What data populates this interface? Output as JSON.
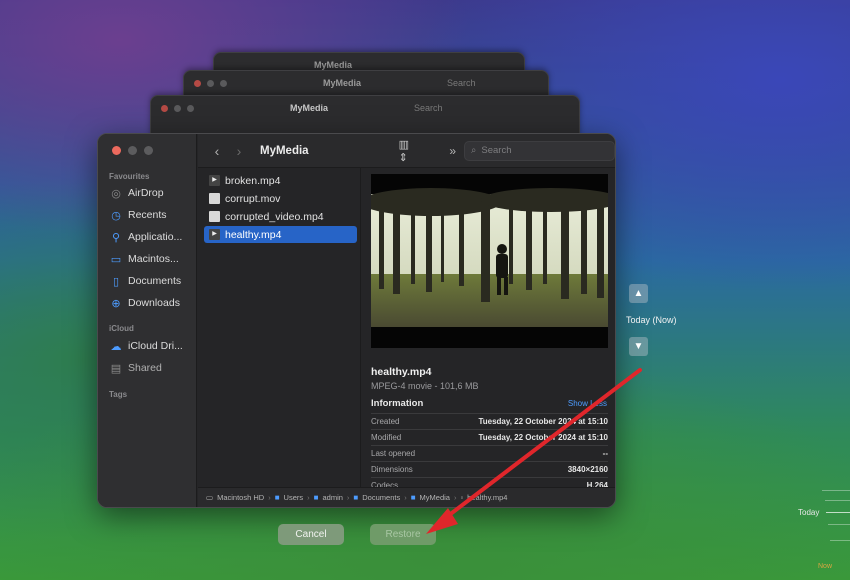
{
  "stack": {
    "title": "MyMedia",
    "search_placeholder": "Search"
  },
  "sidebar": {
    "sections": [
      {
        "label": "Favourites"
      },
      {
        "label": "iCloud"
      },
      {
        "label": "Tags"
      }
    ],
    "items": [
      {
        "label": "AirDrop",
        "icon": "airdrop-icon"
      },
      {
        "label": "Recents",
        "icon": "clock-icon"
      },
      {
        "label": "Applicatio...",
        "icon": "applications-icon"
      },
      {
        "label": "Macintos...",
        "icon": "disk-icon"
      },
      {
        "label": "Documents",
        "icon": "document-icon"
      },
      {
        "label": "Downloads",
        "icon": "download-icon"
      },
      {
        "label": "iCloud Dri...",
        "icon": "cloud-icon"
      },
      {
        "label": "Shared",
        "icon": "shared-folder-icon"
      }
    ]
  },
  "toolbar": {
    "title": "MyMedia",
    "search_placeholder": "Search"
  },
  "files": [
    {
      "name": "broken.mp4",
      "icon": "video-file-icon",
      "selected": false
    },
    {
      "name": "corrupt.mov",
      "icon": "doc-file-icon",
      "selected": false
    },
    {
      "name": "corrupted_video.mp4",
      "icon": "doc-file-icon",
      "selected": false
    },
    {
      "name": "healthy.mp4",
      "icon": "video-file-icon",
      "selected": true
    }
  ],
  "preview": {
    "name": "healthy.mp4",
    "kind": "MPEG-4 movie - 101,6 MB",
    "info_heading": "Information",
    "show_less": "Show Less",
    "rows": [
      {
        "key": "Created",
        "value": "Tuesday, 22 October 2024 at 15:10"
      },
      {
        "key": "Modified",
        "value": "Tuesday, 22 October 2024 at 15:10"
      },
      {
        "key": "Last opened",
        "value": "--"
      },
      {
        "key": "Dimensions",
        "value": "3840×2160"
      },
      {
        "key": "Codecs",
        "value": "H.264"
      }
    ]
  },
  "pathbar": [
    "Macintosh HD",
    "Users",
    "admin",
    "Documents",
    "MyMedia",
    "healthy.mp4"
  ],
  "buttons": {
    "cancel": "Cancel",
    "restore": "Restore"
  },
  "time_machine": {
    "current": "Today (Now)",
    "timeline_today": "Today",
    "timeline_now": "Now"
  },
  "colors": {
    "accent": "#2764c7",
    "annotation_arrow": "#e0262b"
  }
}
